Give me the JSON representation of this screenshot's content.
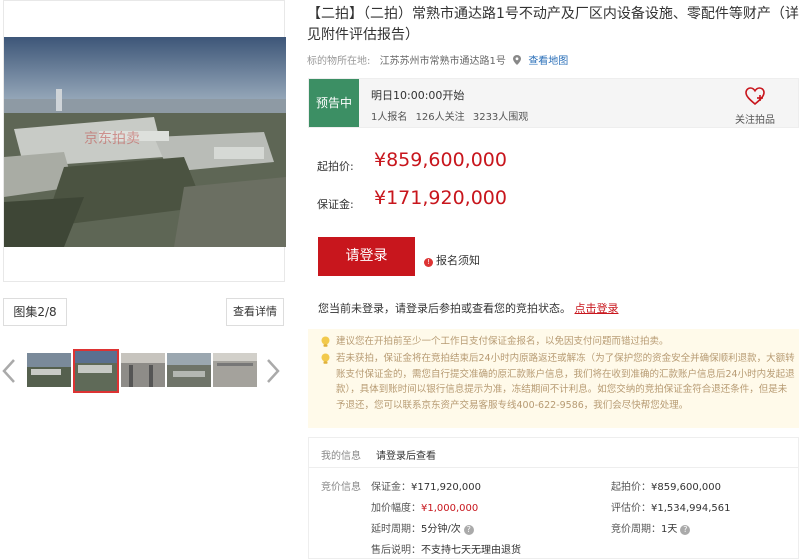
{
  "gallery": {
    "counter_label": "图集2/8",
    "details_button": "查看详情",
    "watermark": "京东拍卖"
  },
  "title": "【二拍】（二拍）常熟市通达路1号不动产及厂区内设备设施、零配件等财产（详见附件评估报告）",
  "location": {
    "label": "标的物所在地:",
    "address": "江苏苏州市常熟市通达路1号",
    "map_link": "查看地图"
  },
  "status": {
    "tag": "预告中",
    "start_time": "明日10:00:00开始",
    "signups": "1人报名",
    "followers": "126人关注",
    "watchers": "3233人围观",
    "follow_label": "关注拍品"
  },
  "prices": {
    "start_label": "起拍价:",
    "start_value": "¥859,600,000",
    "deposit_label": "保证金:",
    "deposit_value": "¥171,920,000"
  },
  "actions": {
    "login_button": "请登录",
    "signup_notice": "报名须知",
    "login_tip": "您当前未登录，请登录后参拍或查看您的竞拍状态。",
    "login_link": "点击登录"
  },
  "tips": {
    "tip1": "建议您在开拍前至少一个工作日支付保证金报名，以免因支付问题而错过拍卖。",
    "tip2": "若未获拍，保证金将在竞拍结束后24小时内原路返还或解冻（为了保护您的资金安全并确保顺利退款，大额转账支付保证金的，需您自行提交准确的原汇款账户信息，我们将在收到准确的汇款账户信息后24小时内发起退款），具体到账时间以银行信息提示为准，冻结期间不计利息。如您交纳的竞拍保证金符合退还条件，但是未予退还，您可以联系京东资产交易客服专线400-622-9586，我们会尽快帮您处理。"
  },
  "info": {
    "my_info_label": "我的信息",
    "my_info_value": "请登录后查看",
    "bid_info_label": "竞价信息",
    "deposit_k": "保证金：",
    "deposit_v": "¥171,920,000",
    "start_k": "起拍价：",
    "start_v": "¥859,600,000",
    "increment_k": "加价幅度：",
    "increment_v": "¥1,000,000",
    "appraisal_k": "评估价：",
    "appraisal_v": "¥1,534,994,561",
    "delay_k": "延时周期：",
    "delay_v": "5分钟/次",
    "period_k": "竞价周期：",
    "period_v": "1天",
    "aftersale_k": "售后说明：",
    "aftersale_v": "不支持七天无理由退货"
  },
  "colors": {
    "accent_red": "#c8161d",
    "status_green": "#3c8f64",
    "tip_bg": "#fffaea",
    "tip_text": "#b79b73"
  },
  "icons": [
    "location-pin-icon",
    "heart-plus-icon",
    "alert-dot-icon",
    "lightbulb-icon",
    "question-icon",
    "chevron-left-icon",
    "chevron-right-icon"
  ]
}
